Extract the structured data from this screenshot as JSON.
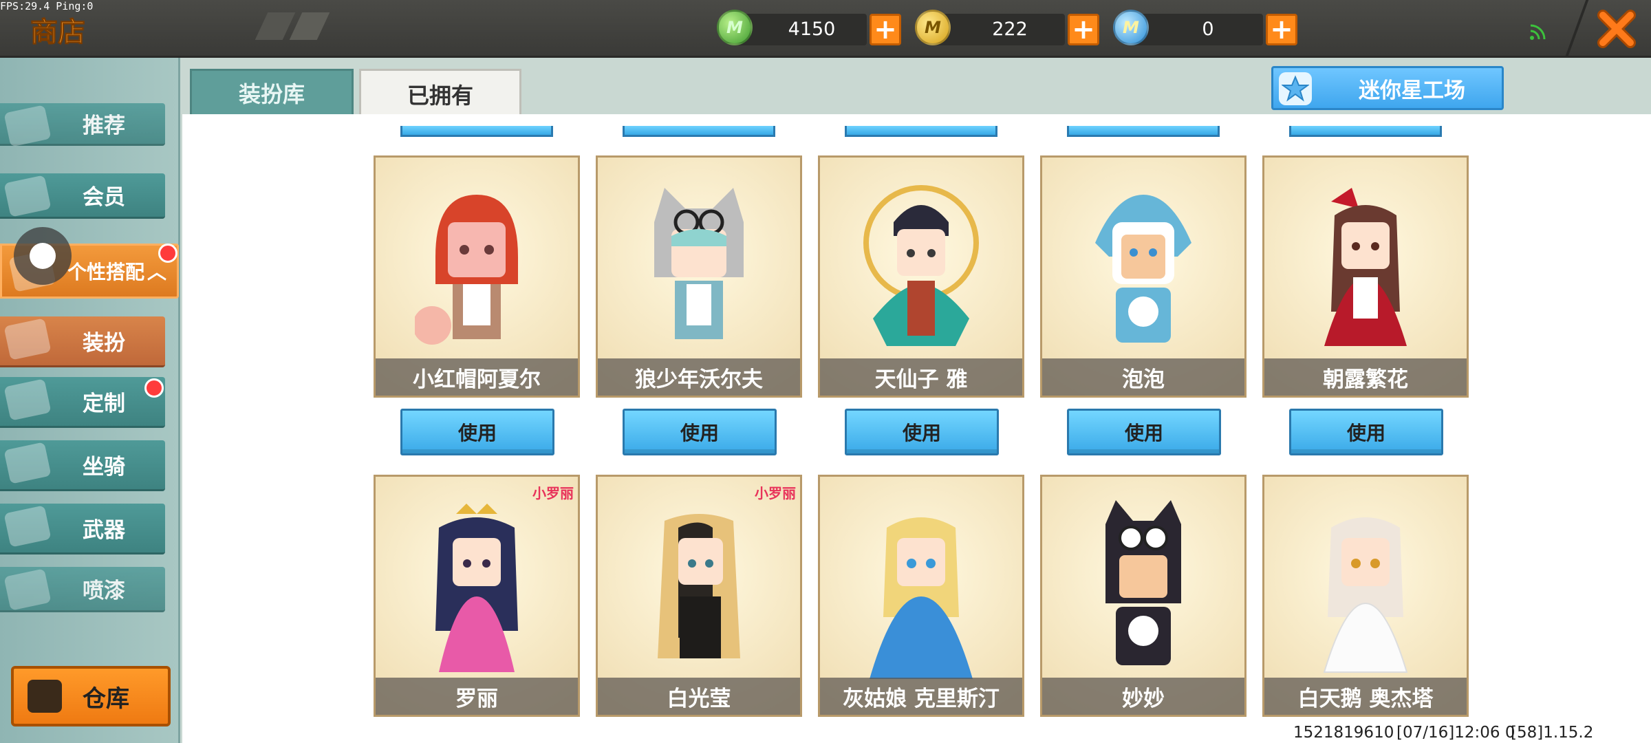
{
  "status": {
    "fps_text": "FPS:29.4  Ping:0"
  },
  "header": {
    "title": "商店",
    "currencies": [
      {
        "icon": "green-gem-coin-icon",
        "symbol": "M",
        "value": "4150"
      },
      {
        "icon": "gold-coin-icon",
        "symbol": "M",
        "value": "222"
      },
      {
        "icon": "blue-star-coin-icon",
        "symbol": "M",
        "value": "0"
      }
    ],
    "plus_label": "+",
    "close_label": "✕"
  },
  "sidebar": {
    "items": [
      {
        "label": "推荐"
      },
      {
        "label": "会员"
      },
      {
        "label": "个性搭配"
      },
      {
        "label": "装扮"
      },
      {
        "label": "定制"
      },
      {
        "label": "坐骑"
      },
      {
        "label": "武器"
      },
      {
        "label": "喷漆"
      }
    ],
    "expand_arrow": "︿",
    "warehouse_label": "仓库"
  },
  "tabs": [
    {
      "label": "装扮库",
      "active": false
    },
    {
      "label": "已拥有",
      "active": true
    }
  ],
  "workshop_label": "迷你星工场",
  "grid": {
    "row1": [
      {
        "name": "小红帽阿夏尔",
        "button": "使用"
      },
      {
        "name": "狼少年沃尔夫",
        "button": "使用"
      },
      {
        "name": "天仙子 雅",
        "button": "使用"
      },
      {
        "name": "泡泡",
        "button": "使用"
      },
      {
        "name": "朝露繁花",
        "button": "使用"
      }
    ],
    "row2": [
      {
        "name": "罗丽",
        "brand": "小罗丽"
      },
      {
        "name": "白光莹",
        "brand": "小罗丽"
      },
      {
        "name": "灰姑娘 克里斯汀"
      },
      {
        "name": "妙妙"
      },
      {
        "name": "白天鹅 奥杰塔"
      }
    ]
  },
  "footer": {
    "uid": "1521819610",
    "timestamp": "[07/16]12:06 0",
    "version": "[58]1.15.2"
  },
  "colors": {
    "accent_orange": "#ff8a1a",
    "teal": "#4f9a98",
    "button_blue": "#3aa9e8"
  }
}
